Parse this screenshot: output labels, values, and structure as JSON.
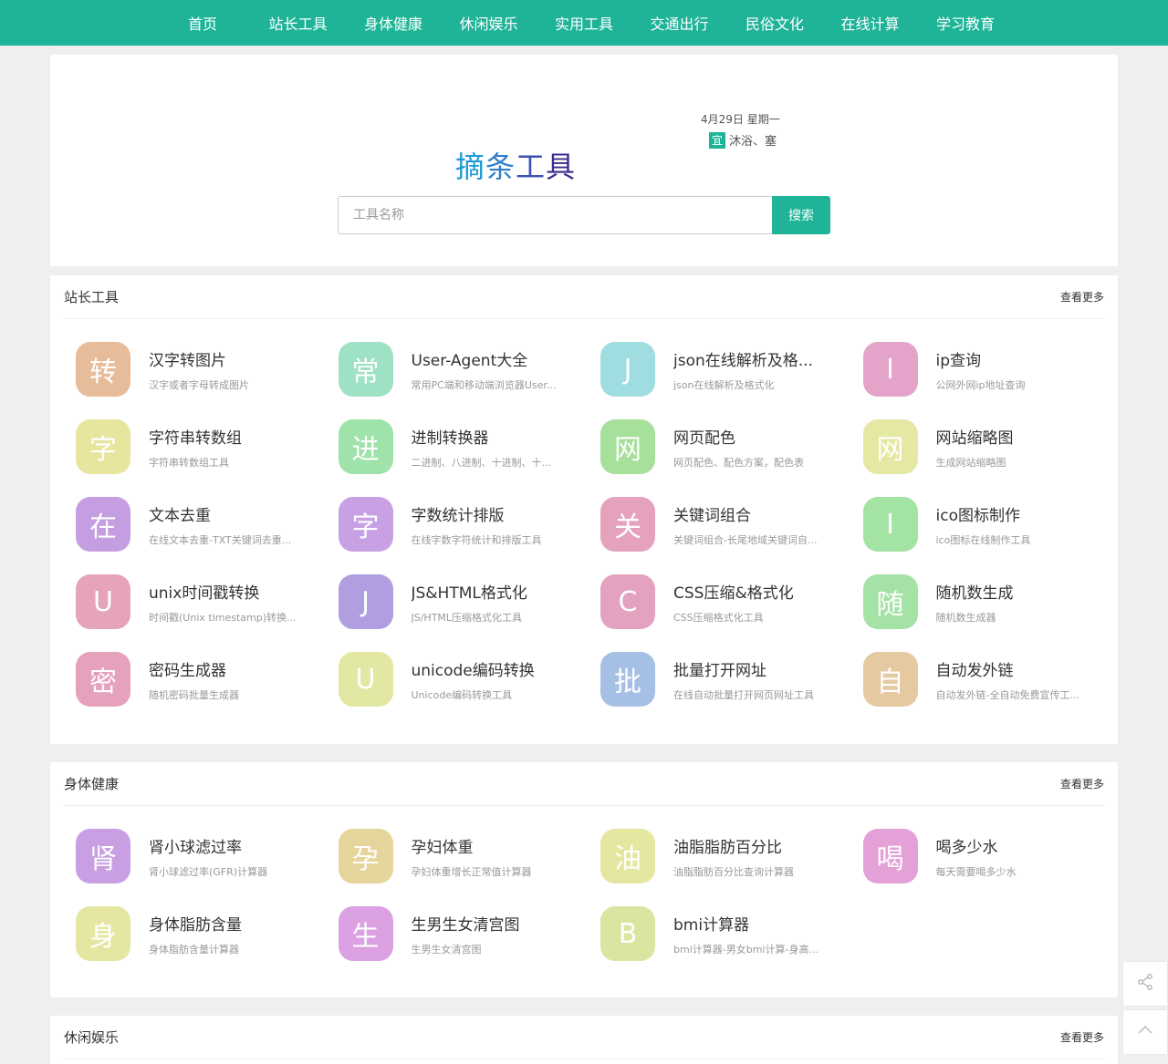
{
  "nav": [
    "首页",
    "站长工具",
    "身体健康",
    "休闲娱乐",
    "实用工具",
    "交通出行",
    "民俗文化",
    "在线计算",
    "学习教育"
  ],
  "hero": {
    "logo_chars": [
      "摘",
      "条",
      "工",
      "具"
    ],
    "logo_colors": [
      "#1a9ad6",
      "#2f7fc9",
      "#3b52b3",
      "#3c2b8f"
    ],
    "date": "4月29日 星期一",
    "yi_badge": "宜",
    "yi_text": "沐浴、塞",
    "search_placeholder": "工具名称",
    "search_button": "搜索"
  },
  "sections": [
    {
      "title": "站长工具",
      "more": "查看更多",
      "items": [
        {
          "icon": "转",
          "color": "#e7bc9a",
          "name": "汉字转图片",
          "desc": "汉字或者字母转成图片"
        },
        {
          "icon": "常",
          "color": "#9fe1c5",
          "name": "User-Agent大全",
          "desc": "常用PC端和移动端浏览器User..."
        },
        {
          "icon": "J",
          "color": "#9fdde0",
          "name": "json在线解析及格...",
          "desc": "json在线解析及格式化"
        },
        {
          "icon": "I",
          "color": "#e4a3c9",
          "name": "ip查询",
          "desc": "公网外网ip地址查询"
        },
        {
          "icon": "字",
          "color": "#e7e59e",
          "name": "字符串转数组",
          "desc": "字符串转数组工具"
        },
        {
          "icon": "进",
          "color": "#9fe2aa",
          "name": "进制转换器",
          "desc": "二进制、八进制、十进制、十..."
        },
        {
          "icon": "网",
          "color": "#a6e09b",
          "name": "网页配色",
          "desc": "网页配色、配色方案，配色表"
        },
        {
          "icon": "网",
          "color": "#e5e8a3",
          "name": "网站缩略图",
          "desc": "生成网站缩略图"
        },
        {
          "icon": "在",
          "color": "#c59ee2",
          "name": "文本去重",
          "desc": "在线文本去重-TXT关键词去重..."
        },
        {
          "icon": "字",
          "color": "#c8a1e5",
          "name": "字数统计排版",
          "desc": "在线字数字符统计和排版工具"
        },
        {
          "icon": "关",
          "color": "#e4a2bd",
          "name": "关键词组合",
          "desc": "关键词组合-长尾地域关键词自..."
        },
        {
          "icon": "I",
          "color": "#a3e3a3",
          "name": "ico图标制作",
          "desc": "ico图标在线制作工具"
        },
        {
          "icon": "U",
          "color": "#e6a3bc",
          "name": "unix时间戳转换",
          "desc": "时间戳(Unix timestamp)转换..."
        },
        {
          "icon": "J",
          "color": "#b09ee0",
          "name": "JS&HTML格式化",
          "desc": "JS/HTML压缩格式化工具"
        },
        {
          "icon": "C",
          "color": "#e3a2bf",
          "name": "CSS压缩&格式化",
          "desc": "CSS压缩格式化工具"
        },
        {
          "icon": "随",
          "color": "#a4e2a5",
          "name": "随机数生成",
          "desc": "随机数生成器"
        },
        {
          "icon": "密",
          "color": "#e6a1bd",
          "name": "密码生成器",
          "desc": "随机密码批量生成器"
        },
        {
          "icon": "U",
          "color": "#e2e7a3",
          "name": "unicode编码转换",
          "desc": "Unicode编码转换工具"
        },
        {
          "icon": "批",
          "color": "#a5bfe5",
          "name": "批量打开网址",
          "desc": "在线自动批量打开网页网址工具"
        },
        {
          "icon": "自",
          "color": "#e5c9a0",
          "name": "自动发外链",
          "desc": "自动发外链-全自动免费宣传工..."
        }
      ]
    },
    {
      "title": "身体健康",
      "more": "查看更多",
      "items": [
        {
          "icon": "肾",
          "color": "#c79fe2",
          "name": "肾小球滤过率",
          "desc": "肾小球滤过率(GFR)计算器"
        },
        {
          "icon": "孕",
          "color": "#e5d59d",
          "name": "孕妇体重",
          "desc": "孕妇体重增长正常值计算器"
        },
        {
          "icon": "油",
          "color": "#e5e69f",
          "name": "油脂脂肪百分比",
          "desc": "油脂脂肪百分比查询计算器"
        },
        {
          "icon": "喝",
          "color": "#e3a1d7",
          "name": "喝多少水",
          "desc": "每天需要喝多少水"
        },
        {
          "icon": "身",
          "color": "#e4e6a1",
          "name": "身体脂肪含量",
          "desc": "身体脂肪含量计算器"
        },
        {
          "icon": "生",
          "color": "#dba1e3",
          "name": "生男生女清宫图",
          "desc": "生男生女清宫图"
        },
        {
          "icon": "B",
          "color": "#d9e6a1",
          "name": "bmi计算器",
          "desc": "bmi计算器-男女bmi计算-身高..."
        }
      ]
    },
    {
      "title": "休闲娱乐",
      "more": "查看更多",
      "items": []
    }
  ],
  "float_buttons": {
    "share_icon": "share-icon",
    "top_icon": "chevron-up-icon"
  }
}
